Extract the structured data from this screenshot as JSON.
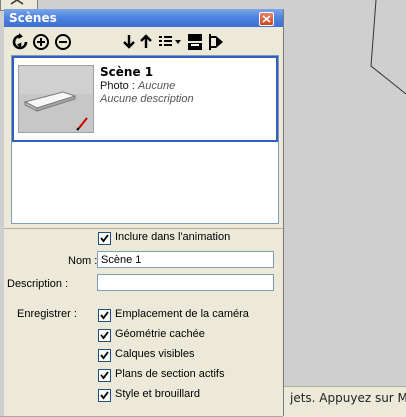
{
  "background": {
    "status_text": "jets. Appuyez sur M"
  },
  "panel": {
    "title": "Scènes",
    "toolbar": {
      "icons": [
        "refresh-icon",
        "add-scene-icon",
        "remove-scene-icon",
        "move-up-icon",
        "move-down-icon",
        "view-options-icon",
        "details-icon",
        "expand-icon"
      ]
    },
    "scene": {
      "name": "Scène 1",
      "photo_label": "Photo :",
      "photo_value": "Aucune",
      "description": "Aucune description"
    },
    "form": {
      "include_animation": "Inclure dans l'animation",
      "name_label": "Nom :",
      "name_value": "Scène 1",
      "description_label": "Description :",
      "description_value": "",
      "save_label": "Enregistrer :",
      "options": [
        "Emplacement de la caméra",
        "Géométrie cachée",
        "Calques visibles",
        "Plans de section actifs",
        "Style et brouillard"
      ]
    }
  },
  "colors": {
    "title_bar": "#4f84e0",
    "selection_border": "#2f5fbf",
    "panel_bg": "#ece9d8"
  }
}
